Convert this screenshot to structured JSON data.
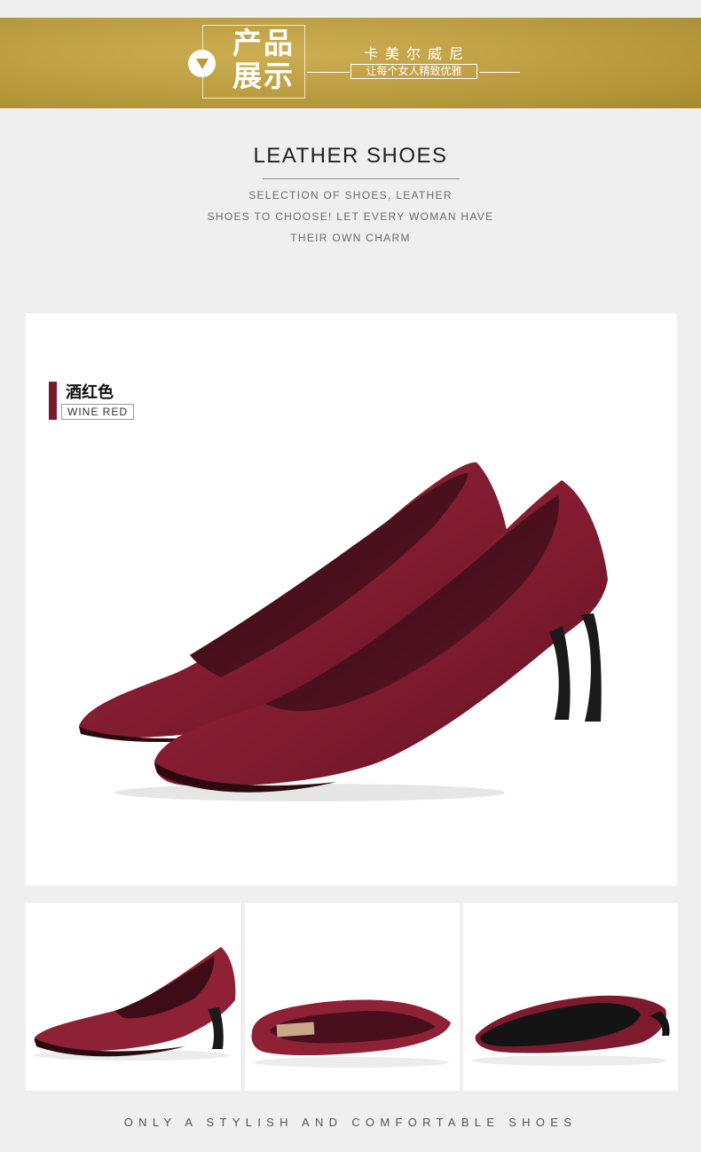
{
  "banner": {
    "title_line1": "产品",
    "title_line2": "展示",
    "brand": "卡美尔威尼",
    "slogan": "让每个女人精致优雅",
    "icon": "play-down-icon",
    "background_color": "#b99a3f"
  },
  "intro": {
    "heading": "LEATHER SHOES",
    "lines": [
      "SELECTION OF SHOES, LEATHER",
      "SHOES TO CHOOSE! LET EVERY WOMAN HAVE",
      "THEIR OWN CHARM"
    ]
  },
  "product": {
    "color_name_cn": "酒红色",
    "color_name_en": "WINE RED",
    "color_swatch": "#7b1a2b"
  },
  "thumbnails": [
    {
      "view": "side view"
    },
    {
      "view": "top view"
    },
    {
      "view": "sole view"
    }
  ],
  "footer": {
    "tagline": "ONLY A STYLISH AND COMFORTABLE SHOES"
  }
}
